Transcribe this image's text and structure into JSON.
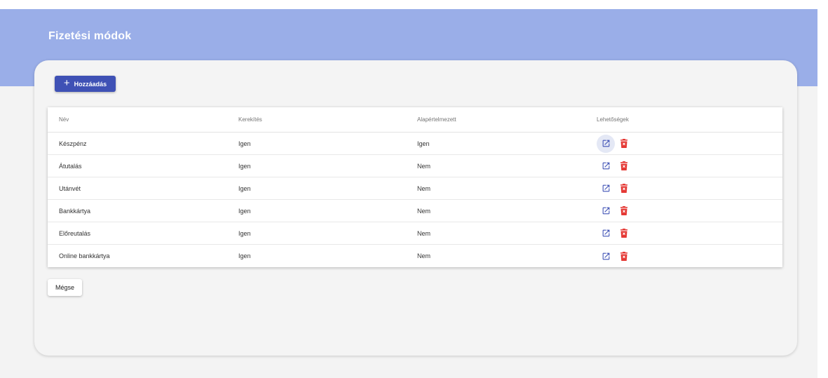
{
  "header": {
    "title": "Fizetési módok"
  },
  "toolbar": {
    "add_label": "Hozzáadás",
    "add_icon": "plus-icon"
  },
  "table": {
    "columns": [
      "Név",
      "Kerekítés",
      "Alapértelmezett",
      "Lehetőségek"
    ],
    "rows": [
      {
        "name": "Készpénz",
        "rounding": "Igen",
        "default": "Igen"
      },
      {
        "name": "Átutalás",
        "rounding": "Igen",
        "default": "Nem"
      },
      {
        "name": "Utánvét",
        "rounding": "Igen",
        "default": "Nem"
      },
      {
        "name": "Bankkártya",
        "rounding": "Igen",
        "default": "Nem"
      },
      {
        "name": "Előreutalás",
        "rounding": "Igen",
        "default": "Nem"
      },
      {
        "name": "Online bankkártya",
        "rounding": "Igen",
        "default": "Nem"
      }
    ],
    "action_icons": {
      "edit": "edit-icon",
      "delete": "delete-icon"
    }
  },
  "footer": {
    "cancel_label": "Mégse"
  },
  "colors": {
    "header": "#9aaee8",
    "primary": "#3f51b5",
    "edit": "#3f51b5",
    "delete": "#e53935",
    "background": "#f3f3f3"
  }
}
